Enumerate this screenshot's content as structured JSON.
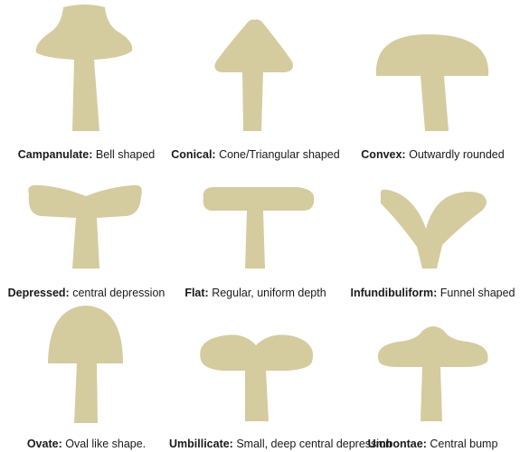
{
  "shapes": [
    {
      "term": "Campanulate:",
      "desc": "Bell shaped"
    },
    {
      "term": "Conical:",
      "desc": "Cone/Triangular shaped"
    },
    {
      "term": "Convex:",
      "desc": "Outwardly rounded"
    },
    {
      "term": "Depressed:",
      "desc": "central depression"
    },
    {
      "term": "Flat:",
      "desc": "Regular, uniform depth"
    },
    {
      "term": "Infundibuliform:",
      "desc": "Funnel shaped"
    },
    {
      "term": "Ovate:",
      "desc": "Oval like shape."
    },
    {
      "term": "Umbillicate:",
      "desc": "Small, deep central depression"
    },
    {
      "term": "Umbontae:",
      "desc": "Central bump"
    }
  ],
  "colors": {
    "shape_fill": "#d4cb9f",
    "text": "#1a1a1a",
    "background": "#ffffff"
  }
}
